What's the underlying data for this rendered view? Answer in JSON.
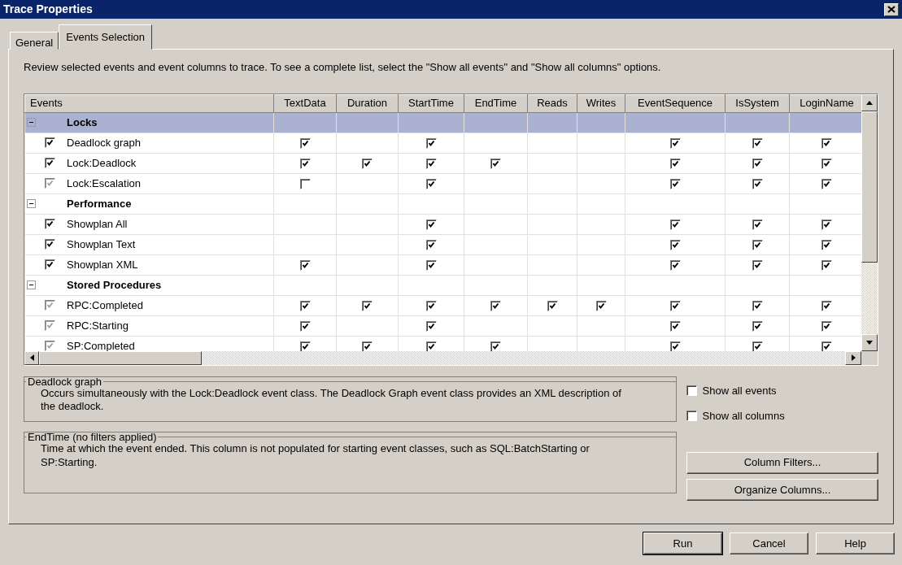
{
  "window": {
    "title": "Trace Properties"
  },
  "tabs": [
    {
      "label": "General",
      "selected": false
    },
    {
      "label": "Events Selection",
      "selected": true
    }
  ],
  "instructions": "Review selected events and event columns to trace. To see a complete list, select the \"Show all events\" and \"Show all columns\" options.",
  "grid": {
    "columns": [
      "Events",
      "TextData",
      "Duration",
      "StartTime",
      "EndTime",
      "Reads",
      "Writes",
      "EventSequence",
      "IsSystem",
      "LoginName"
    ],
    "groups": [
      {
        "name": "Locks",
        "expanded": true,
        "selected": true,
        "events": [
          {
            "name": "Deadlock graph",
            "checked": true,
            "disabled": false,
            "cells": [
              true,
              null,
              true,
              null,
              null,
              null,
              true,
              true,
              true
            ]
          },
          {
            "name": "Lock:Deadlock",
            "checked": true,
            "disabled": false,
            "cells": [
              true,
              true,
              true,
              true,
              null,
              null,
              true,
              true,
              true
            ]
          },
          {
            "name": "Lock:Escalation",
            "checked": true,
            "disabled": true,
            "cells": [
              false,
              null,
              true,
              null,
              null,
              null,
              true,
              true,
              true
            ]
          }
        ]
      },
      {
        "name": "Performance",
        "expanded": true,
        "selected": false,
        "events": [
          {
            "name": "Showplan All",
            "checked": true,
            "disabled": false,
            "cells": [
              null,
              null,
              true,
              null,
              null,
              null,
              true,
              true,
              true
            ]
          },
          {
            "name": "Showplan Text",
            "checked": true,
            "disabled": false,
            "cells": [
              null,
              null,
              true,
              null,
              null,
              null,
              true,
              true,
              true
            ]
          },
          {
            "name": "Showplan XML",
            "checked": true,
            "disabled": false,
            "cells": [
              true,
              null,
              true,
              null,
              null,
              null,
              true,
              true,
              true
            ]
          }
        ]
      },
      {
        "name": "Stored Procedures",
        "expanded": true,
        "selected": false,
        "events": [
          {
            "name": "RPC:Completed",
            "checked": true,
            "disabled": true,
            "cells": [
              true,
              true,
              true,
              true,
              true,
              true,
              true,
              true,
              true
            ]
          },
          {
            "name": "RPC:Starting",
            "checked": true,
            "disabled": true,
            "cells": [
              true,
              null,
              true,
              null,
              null,
              null,
              true,
              true,
              true
            ]
          },
          {
            "name": "SP:Completed",
            "checked": true,
            "disabled": true,
            "cells": [
              true,
              true,
              true,
              true,
              null,
              null,
              true,
              true,
              true
            ]
          }
        ]
      }
    ]
  },
  "event_description": {
    "title": "Deadlock graph",
    "text": "Occurs simultaneously with the Lock:Deadlock event class. The Deadlock Graph event class provides an XML description of the deadlock."
  },
  "options": [
    {
      "label": "Show all events",
      "checked": false
    },
    {
      "label": "Show all columns",
      "checked": false
    }
  ],
  "column_description": {
    "title": "EndTime (no filters applied)",
    "text": "Time at which the event ended. This column is not populated for starting event classes, such as SQL:BatchStarting or SP:Starting."
  },
  "side_buttons": [
    "Column Filters...",
    "Organize Columns..."
  ],
  "buttons": [
    {
      "label": "Run",
      "default": true
    },
    {
      "label": "Cancel",
      "default": false
    },
    {
      "label": "Help",
      "default": false
    }
  ]
}
